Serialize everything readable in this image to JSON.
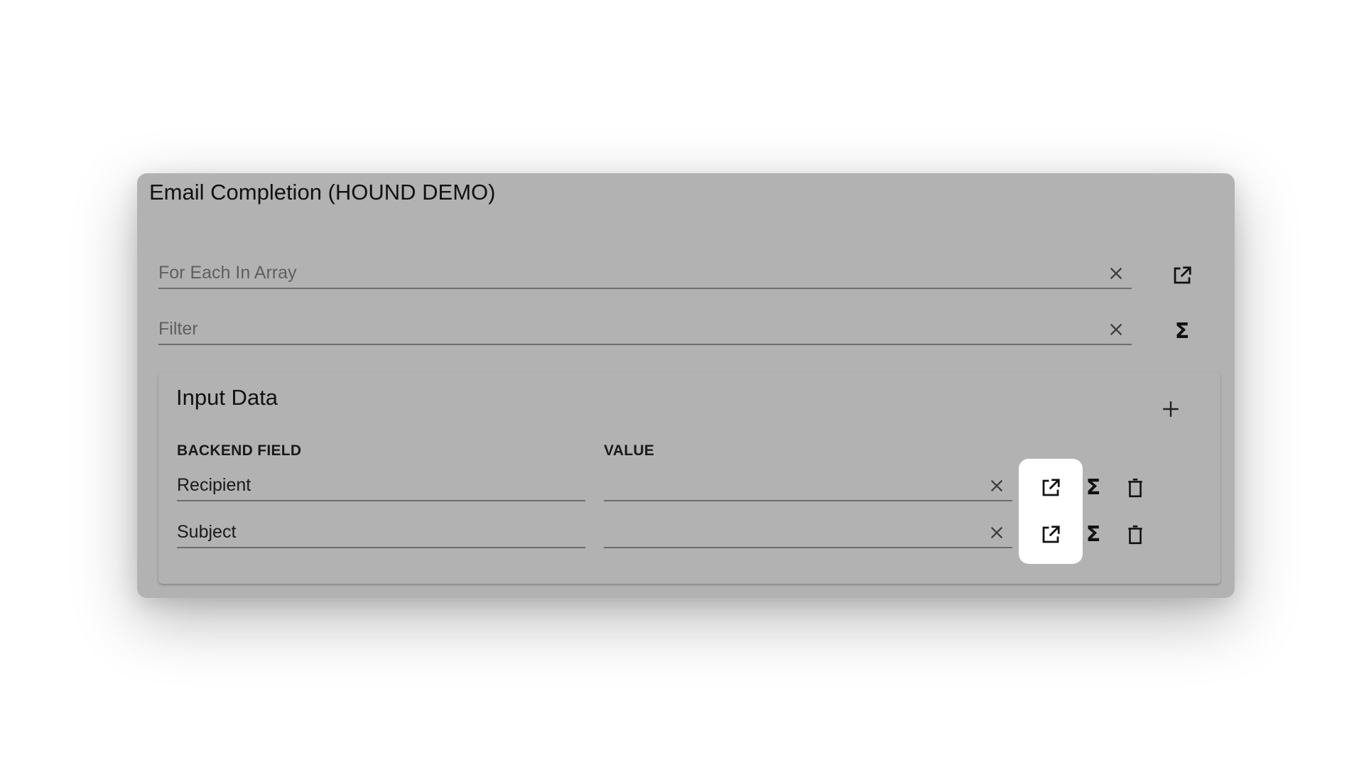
{
  "dialog": {
    "title": "Email Completion (HOUND DEMO)"
  },
  "for_each": {
    "placeholder": "For Each In Array",
    "value": ""
  },
  "filter": {
    "placeholder": "Filter",
    "value": ""
  },
  "input_data": {
    "title": "Input Data",
    "columns": {
      "backend_field": "BACKEND FIELD",
      "value": "VALUE"
    },
    "rows": [
      {
        "backend_field": "Recipient",
        "value": ""
      },
      {
        "backend_field": "Subject",
        "value": ""
      }
    ]
  },
  "icons": {
    "clear": "close-icon",
    "open": "open-in-new-icon",
    "formula": "sigma-icon",
    "delete": "trash-icon",
    "add": "plus-icon"
  },
  "colors": {
    "panel_background": "#b2b2b2",
    "highlight": "#ffffff",
    "text": "#111111"
  }
}
